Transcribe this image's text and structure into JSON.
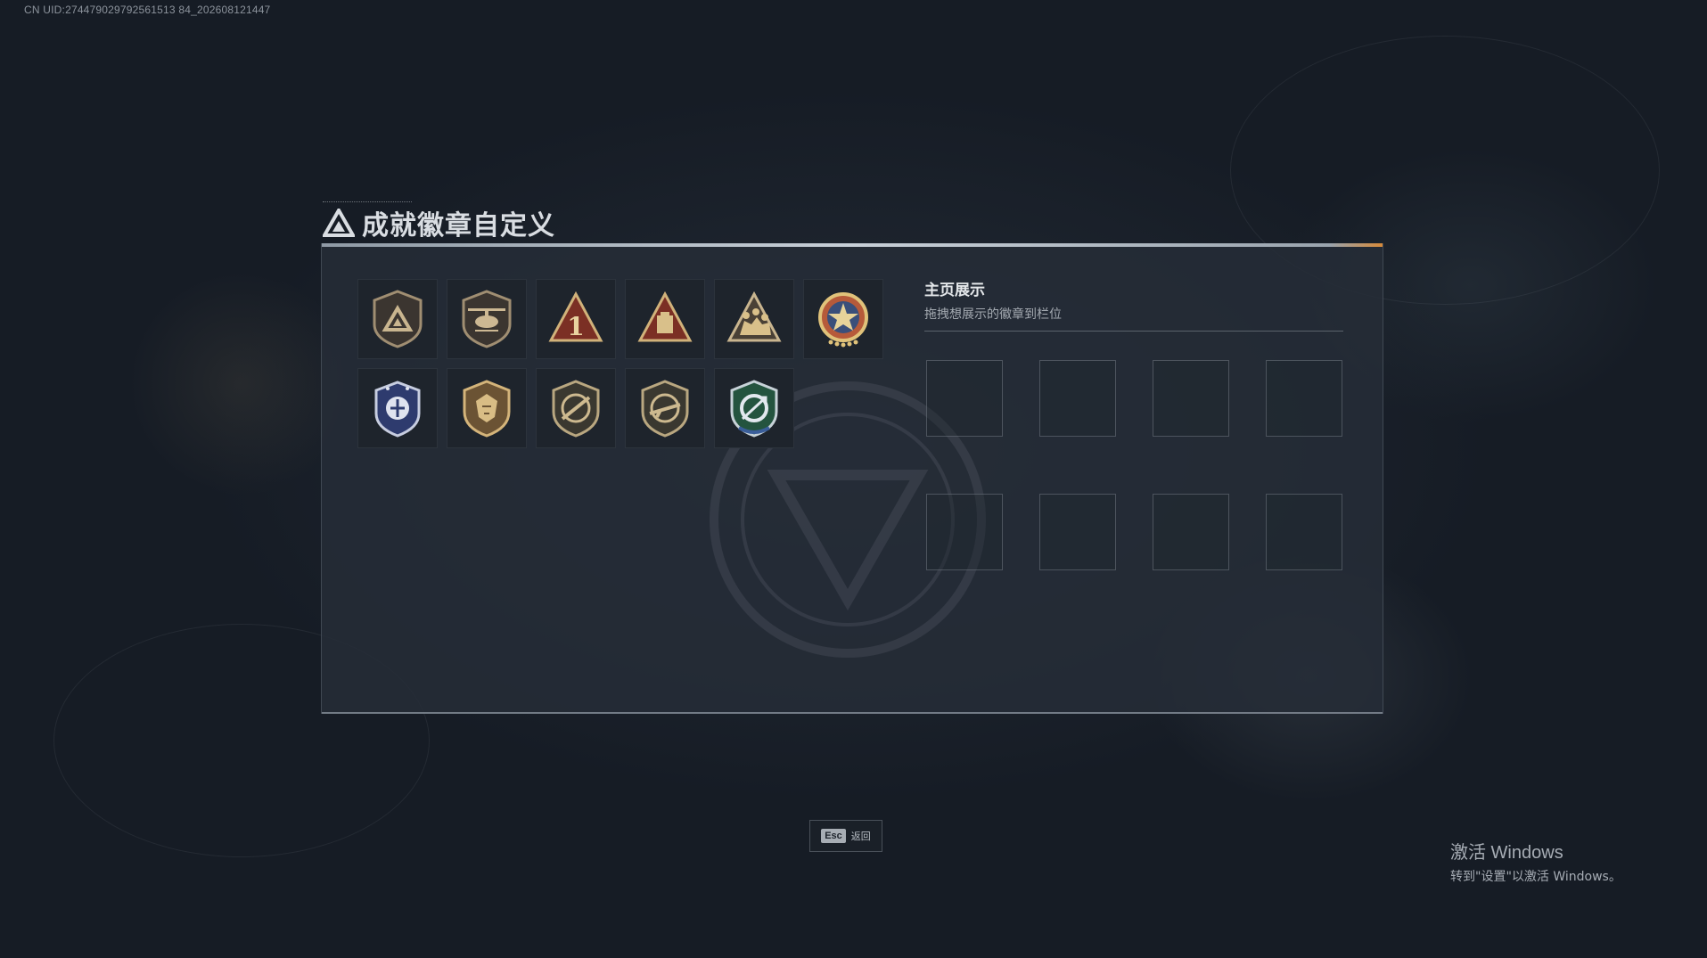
{
  "uid": "CN UID:274479029792561513 84_202608121447",
  "dialog": {
    "title": "成就徽章自定义",
    "title_icon": "triangle-logo-icon"
  },
  "badges": [
    {
      "name": "shield-triangle-badge",
      "color": "#6b5d4a"
    },
    {
      "name": "helicopter-badge",
      "color": "#6b5d4a"
    },
    {
      "name": "rank-one-triangle-badge",
      "color": "#8a3a2a"
    },
    {
      "name": "crate-triangle-badge",
      "color": "#8a3a2a"
    },
    {
      "name": "squad-triangle-badge",
      "color": "#6b5d4a"
    },
    {
      "name": "star-medal-badge",
      "color": "#a03c3c"
    },
    {
      "name": "blue-eagle-badge",
      "color": "#3a4a8a"
    },
    {
      "name": "lion-shield-badge",
      "color": "#6b5d4a"
    },
    {
      "name": "rifle-shield-badge",
      "color": "#5e5a4c"
    },
    {
      "name": "sniper-shield-badge",
      "color": "#5e5a4c"
    },
    {
      "name": "green-arrows-badge",
      "color": "#2f5f4a"
    }
  ],
  "showcase": {
    "title": "主页展示",
    "subtitle": "拖拽想展示的徽章到栏位",
    "slots": 8
  },
  "esc": {
    "key": "Esc",
    "label": "返回"
  },
  "windows_watermark": {
    "title": "激活 Windows",
    "subtitle": "转到\"设置\"以激活 Windows。"
  }
}
